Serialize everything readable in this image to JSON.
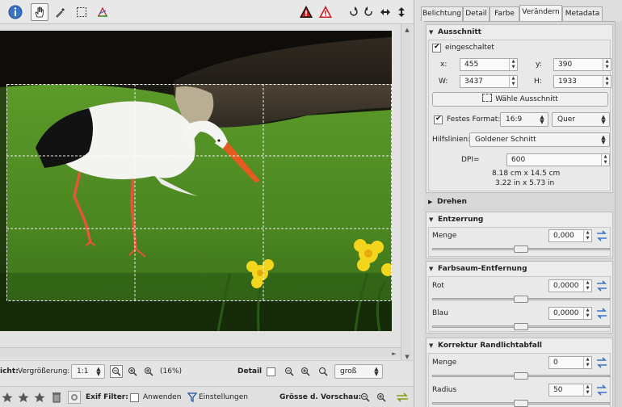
{
  "status_bar": {
    "ansicht_fragment": "icht:",
    "vergroesserung_label": "Vergrößerung:",
    "zoom_value": "1:1",
    "zoom_percent": "(16%)",
    "detail_label": "Detail",
    "detail_value": "groß"
  },
  "filter_bar": {
    "exif_filter_label": "Exif Filter:",
    "anwenden_label": "Anwenden",
    "einstellungen_label": "Einstellungen",
    "groesse_label": "Grösse d. Vorschau:"
  },
  "tabs": [
    {
      "label": "Belichtung"
    },
    {
      "label": "Detail"
    },
    {
      "label": "Farbe"
    },
    {
      "label": "Verändern"
    },
    {
      "label": "Metadata"
    }
  ],
  "ausschnitt": {
    "title": "Ausschnitt",
    "enabled_label": "eingeschaltet",
    "x_label": "x:",
    "x_value": "455",
    "y_label": "y:",
    "y_value": "390",
    "w_label": "W:",
    "w_value": "3437",
    "h_label": "H:",
    "h_value": "1933",
    "select_button": "Wähle Ausschnitt",
    "fixed_format_label": "Festes Format:",
    "ratio_value": "16:9",
    "orientation_value": "Quer",
    "guides_label": "Hilfslinien:",
    "guides_value": "Goldener Schnitt",
    "dpi_label": "DPI=",
    "dpi_value": "600",
    "size_cm": "8.18 cm x 14.5 cm",
    "size_in": "3.22 in x 5.73 in"
  },
  "drehen": {
    "title": "Drehen"
  },
  "entzerrung": {
    "title": "Entzerrung",
    "menge_label": "Menge",
    "menge_value": "0,000",
    "menge_level": 0.5
  },
  "farbsaum": {
    "title": "Farbsaum-Entfernung",
    "rot_label": "Rot",
    "rot_value": "0,0000",
    "rot_level": 0.5,
    "blau_label": "Blau",
    "blau_value": "0,0000",
    "blau_level": 0.5
  },
  "randlicht": {
    "title": "Korrektur Randlichtabfall",
    "menge_label": "Menge",
    "menge_value": "0",
    "menge_level": 0.5,
    "radius_label": "Radius",
    "radius_value": "50",
    "radius_level": 0.5
  },
  "colors": {
    "accent": "#3a73c4",
    "warning": "#cc1f1f",
    "grass": "#4d8a22"
  }
}
